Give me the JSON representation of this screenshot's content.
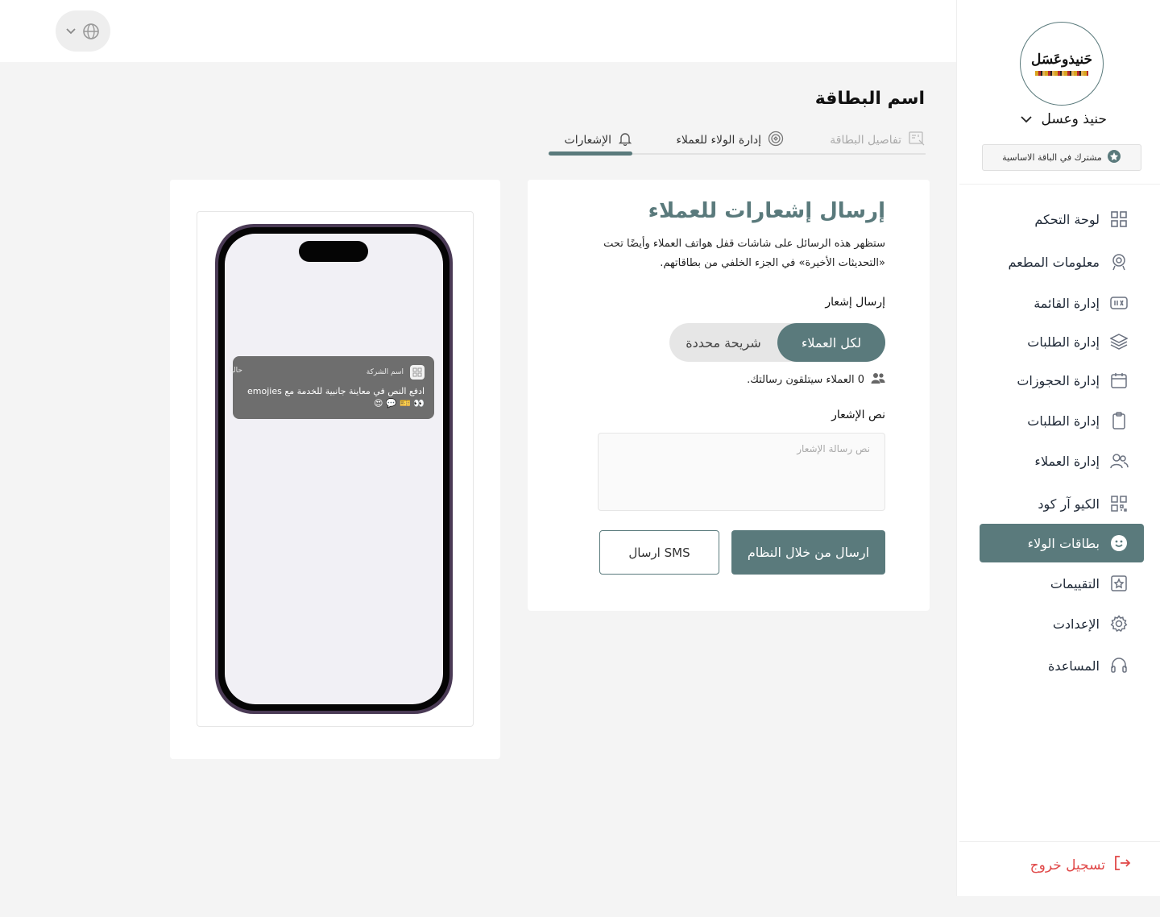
{
  "app": {
    "brand_name": "حنيذ وعسل",
    "logo_text": "حَنيذوعَسَل",
    "plan_badge": "مشترك في الباقة الاساسية"
  },
  "topbar": {
    "language_icon": "globe-icon"
  },
  "sidebar": {
    "items": [
      {
        "label": "لوحة التحكم",
        "icon": "grid-icon"
      },
      {
        "label": "معلومات المطعم",
        "icon": "restaurant-icon"
      },
      {
        "label": "إدارة القائمة",
        "icon": "menu-icon"
      },
      {
        "label": "إدارة الطلبات",
        "icon": "layers-icon"
      },
      {
        "label": "إدارة الحجوزات",
        "icon": "calendar-icon"
      },
      {
        "label": "إدارة الطلبات",
        "icon": "clipboard-icon"
      },
      {
        "label": "إدارة العملاء",
        "icon": "users-icon"
      },
      {
        "label": "الكيو آر كود",
        "icon": "qr-icon"
      },
      {
        "label": "بطاقات الولاء",
        "icon": "smiley-icon",
        "active": true
      },
      {
        "label": "التقييمات",
        "icon": "star-icon"
      },
      {
        "label": "الإعدادت",
        "icon": "gear-icon"
      },
      {
        "label": "المساعدة",
        "icon": "headset-icon"
      }
    ],
    "logout": "تسجيل خروج"
  },
  "main": {
    "page_title": "اسم البطاقة",
    "tabs": [
      {
        "label": "تفاصيل البطاقة",
        "icon": "card-details-icon"
      },
      {
        "label": "إدارة الولاء للعملاء",
        "icon": "loyalty-icon"
      },
      {
        "label": "الإشعارات",
        "icon": "bell-icon",
        "active": true
      }
    ]
  },
  "form": {
    "title": "إرسال إشعارات للعملاء",
    "description": "ستظهر هذه الرسائل على شاشات قفل هواتف العملاء وأيضًا تحت «التحديثات الأخيرة» في الجزء الخلفي من بطاقاتهم.",
    "send_label": "إرسال إشعار",
    "audience_all": "لكل العملاء",
    "audience_segment": "شريحة محددة",
    "recipients_text": "0 العملاء سيتلقون رسالتك.",
    "message_label": "نص الإشعار",
    "message_placeholder": "نص رسالة الإشعار",
    "message_value": "",
    "send_system_button": "ارسال من خلال النظام",
    "send_sms_button": "ارسال SMS"
  },
  "preview": {
    "notification": {
      "app_name": "اسم الشركة",
      "time": "حاليا",
      "body": "ادفع النص في معاينة جانبية للخدمة مع emojies 👀 🎫 💬 😍"
    }
  },
  "colors": {
    "accent": "#5a7a7c",
    "danger": "#e04848",
    "background": "#f4f4f4"
  }
}
